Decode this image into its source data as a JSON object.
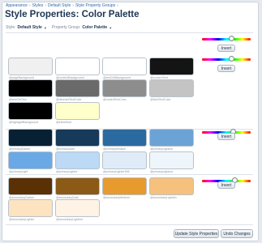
{
  "breadcrumb": [
    "Appearance",
    "Styles",
    "Default Style",
    "Style Property Groups"
  ],
  "breadcrumb_sep": "›",
  "page_title": "Style Properties: Color Palette",
  "style_selector": {
    "label": "Style:",
    "value": "Default Style"
  },
  "group_selector": {
    "label": "Property Group:",
    "value": "Color Palette"
  },
  "invert_label": "Invert",
  "hue_slider_1": 0.55,
  "hue_slider_2": 0.55,
  "swatches": [
    {
      "label": "@pageBackground",
      "color": "#f0f0f0"
    },
    {
      "label": "@contentBackground",
      "color": "#ffffff"
    },
    {
      "label": "@textCtrlBackground",
      "color": "#ffffff"
    },
    {
      "label": "@contentText",
      "color": "#141414"
    },
    {
      "label": "@textCtrlText",
      "color": "#000000"
    },
    {
      "label": "@dimmedTextColor",
      "color": "#6a6a6a"
    },
    {
      "label": "@mutedTextColor",
      "color": "#8d8d8d"
    },
    {
      "label": "@faintTextColor",
      "color": "#c4c4c4"
    },
    {
      "label": "@highlightBackground",
      "color": "#000000"
    },
    {
      "label": "@inlineMod",
      "color": "#ffffcc"
    },
    {
      "label": "@primaryDarker",
      "color": "#072033"
    },
    {
      "label": "@primaryDark",
      "color": "#17395a"
    },
    {
      "label": "@primaryMedium",
      "color": "#2a6aa0"
    },
    {
      "label": "@primaryLightish",
      "color": "#6ca3d6"
    },
    {
      "label": "@primaryLight",
      "color": "#6aa9e6"
    },
    {
      "label": "@primaryLighter",
      "color": "#bcd9f5"
    },
    {
      "label": "@primaryLighterStill",
      "color": "#dfecf8"
    },
    {
      "label": "@primaryLightest",
      "color": "#eef5fb"
    },
    {
      "label": "@secondaryDarker",
      "color": "#5a3005"
    },
    {
      "label": "@secondaryDark",
      "color": "#8b5a16"
    },
    {
      "label": "@secondaryMedium",
      "color": "#e79a2e"
    },
    {
      "label": "@secondaryLightish",
      "color": "#f6c17c"
    },
    {
      "label": "@secondaryLighter",
      "color": "#fde3bf"
    },
    {
      "label": "@secondaryLightest",
      "color": "#fff3e6"
    }
  ],
  "footer": {
    "save_label": "Update Style Properties",
    "undo_label": "Undo Changes"
  }
}
